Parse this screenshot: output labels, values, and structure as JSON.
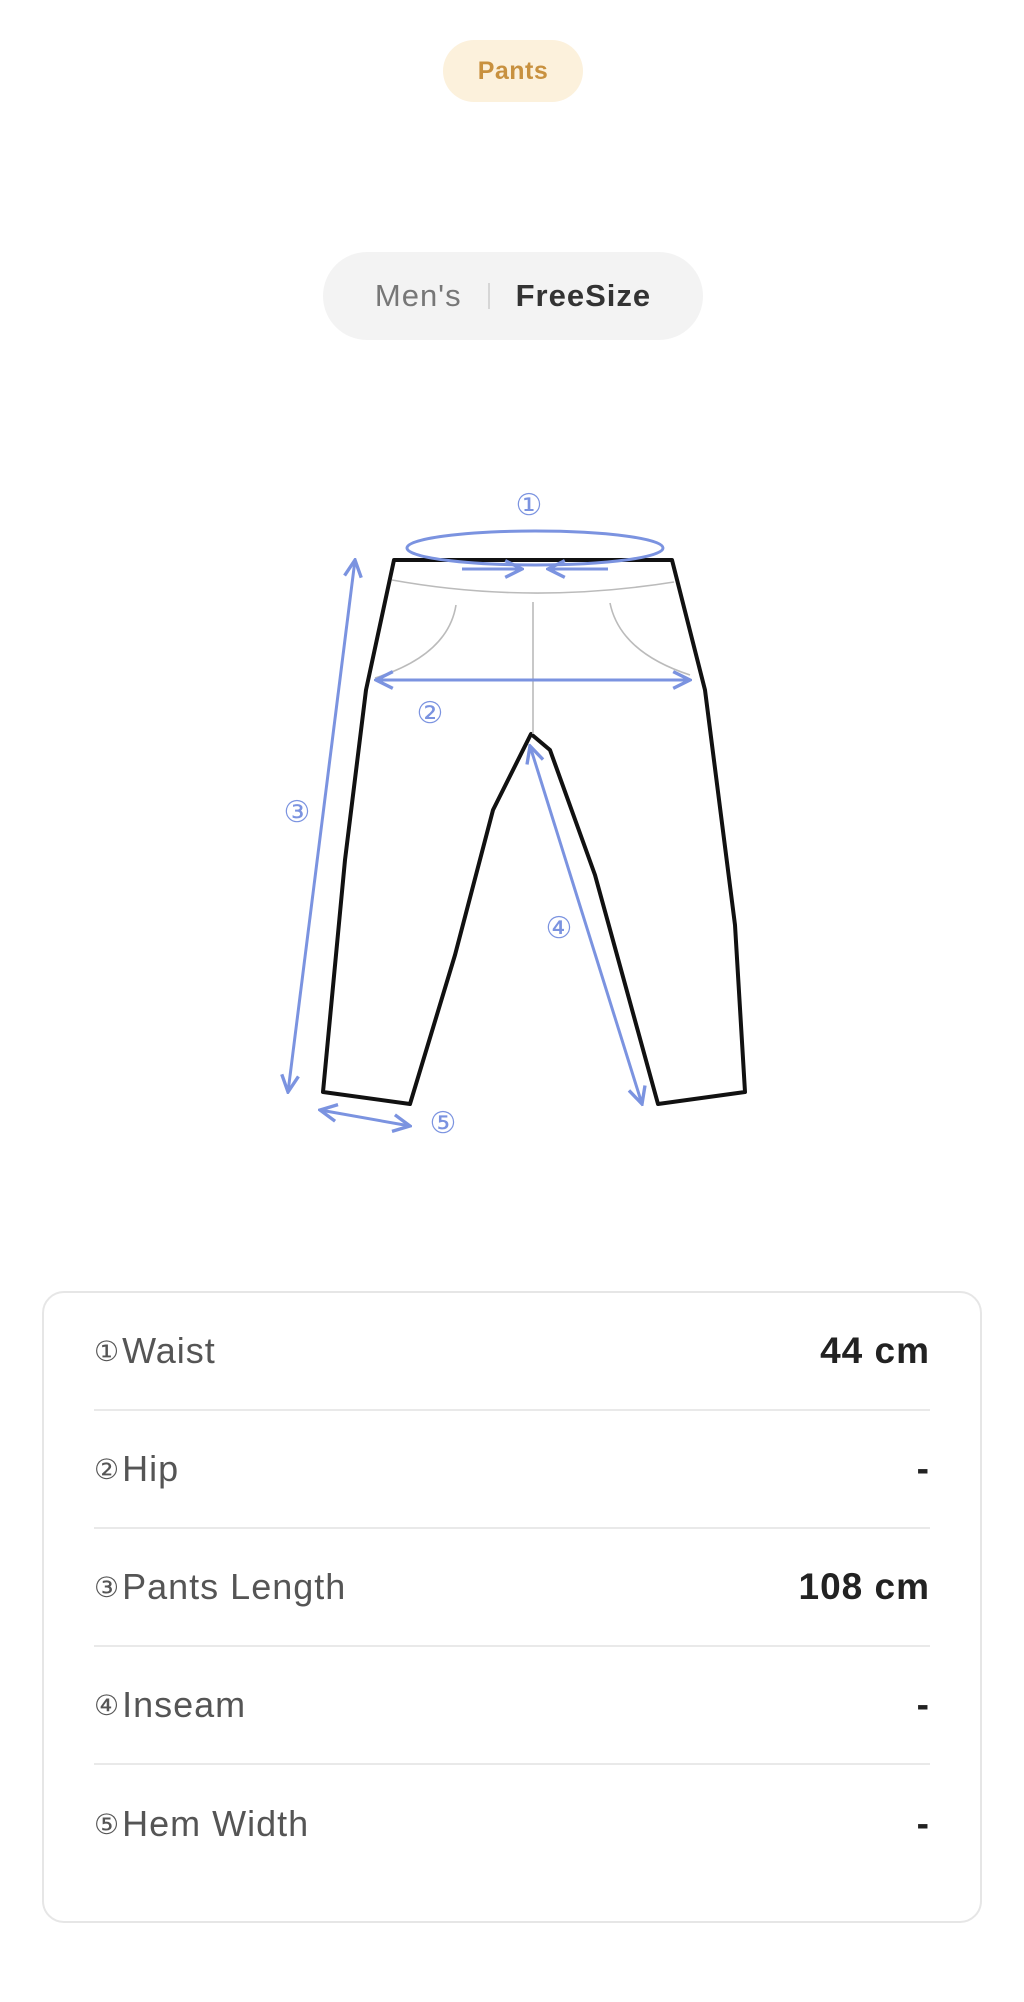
{
  "category": {
    "label": "Pants"
  },
  "size_selector": {
    "gender": "Men's",
    "size": "FreeSize"
  },
  "diagram": {
    "markers": [
      "①",
      "②",
      "③",
      "④",
      "⑤"
    ],
    "accent_color": "#7b93e0"
  },
  "measurements": [
    {
      "num": "①",
      "label": "Waist",
      "value": "44 cm"
    },
    {
      "num": "②",
      "label": "Hip",
      "value": "-"
    },
    {
      "num": "③",
      "label": "Pants Length",
      "value": "108 cm"
    },
    {
      "num": "④",
      "label": "Inseam",
      "value": "-"
    },
    {
      "num": "⑤",
      "label": "Hem Width",
      "value": "-"
    }
  ]
}
